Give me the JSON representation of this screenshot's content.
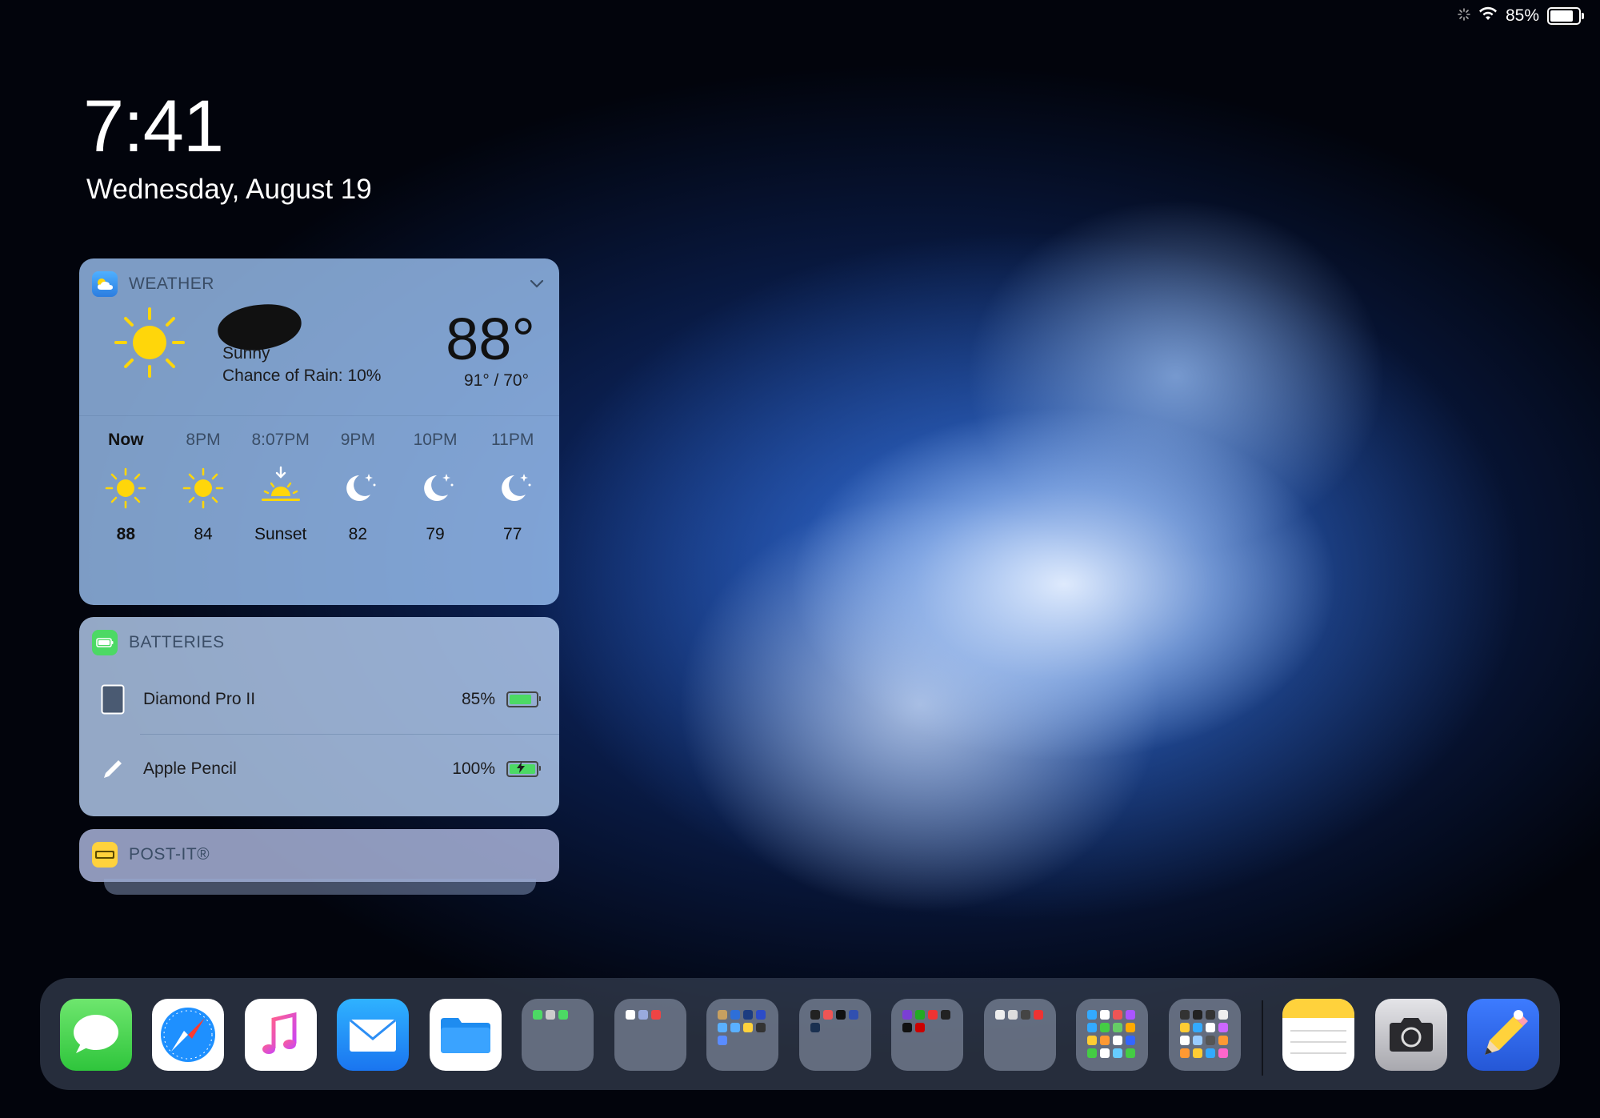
{
  "status_bar": {
    "battery_percent": "85%",
    "battery_level": 0.85
  },
  "lock": {
    "time": "7:41",
    "date": "Wednesday, August 19"
  },
  "weather_widget": {
    "title": "WEATHER",
    "condition": "Sunny",
    "rain_chance": "Chance of Rain: 10%",
    "temperature": "88°",
    "high_low": "91° / 70°",
    "hourly": [
      {
        "label": "Now",
        "value": "88",
        "icon": "sun-icon"
      },
      {
        "label": "8PM",
        "value": "84",
        "icon": "sun-icon"
      },
      {
        "label": "8:07PM",
        "value": "Sunset",
        "icon": "sunset-icon"
      },
      {
        "label": "9PM",
        "value": "82",
        "icon": "moon-icon"
      },
      {
        "label": "10PM",
        "value": "79",
        "icon": "moon-icon"
      },
      {
        "label": "11PM",
        "value": "77",
        "icon": "moon-icon"
      }
    ]
  },
  "batteries_widget": {
    "title": "BATTERIES",
    "devices": [
      {
        "name": "Diamond Pro II",
        "percent": "85%",
        "level": 0.85,
        "charging": false,
        "icon": "ipad-icon"
      },
      {
        "name": "Apple Pencil",
        "percent": "100%",
        "level": 1.0,
        "charging": true,
        "icon": "pencil-icon"
      }
    ]
  },
  "postit_widget": {
    "title": "POST-IT®"
  },
  "dock": {
    "apps": [
      "messages-icon",
      "safari-icon",
      "music-icon",
      "mail-icon",
      "files-icon"
    ],
    "folders": 8,
    "recent_apps": [
      "notes-icon",
      "camera-icon",
      "notability-icon"
    ]
  },
  "colors": {
    "accent_green": "#4cd964",
    "wallpaper_blue": "#1c4fa8"
  }
}
